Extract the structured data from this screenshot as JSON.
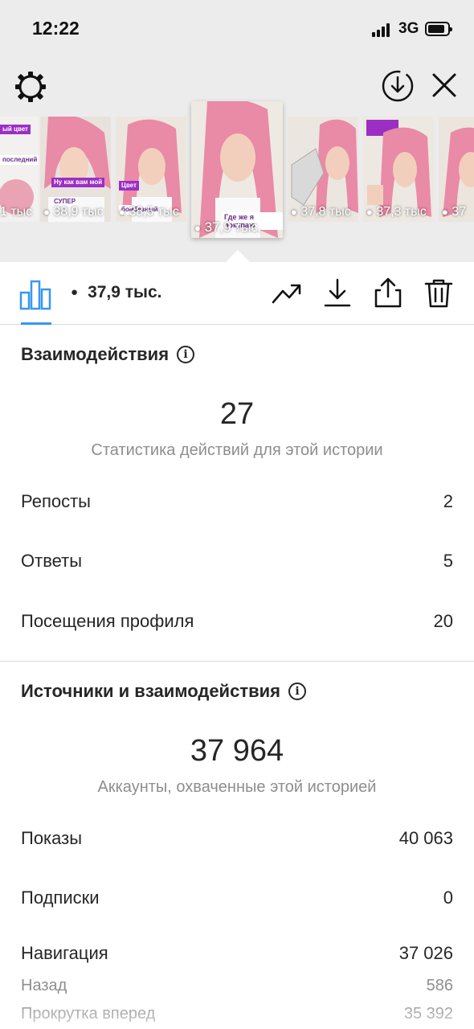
{
  "status_bar": {
    "time": "12:22",
    "network": "3G"
  },
  "header": {
    "settings_icon": "gear-icon",
    "download_icon": "download-circle-icon",
    "close_icon": "close-icon"
  },
  "stories": [
    {
      "count": "1 тыс",
      "tag1": "ый цвет",
      "tag2": "последний"
    },
    {
      "count": "38,9 тыс",
      "tag1": "Ну как вам мой",
      "tag2": "СУПЕР"
    },
    {
      "count": "38,5 тыс",
      "tag1": "Цвет",
      "tag2": "бомбезный"
    },
    {
      "count": "37,9 тыс.",
      "tag1": "Где же я покупаю",
      "tag2": ""
    },
    {
      "count": "37,8 тыс",
      "tag1": "",
      "tag2": ""
    },
    {
      "count": "37,3 тыс",
      "tag1": "",
      "tag2": ""
    },
    {
      "count": "37",
      "tag1": "",
      "tag2": ""
    }
  ],
  "toolbar": {
    "views": "37,9 тыс.",
    "icons": [
      "bar-chart-icon",
      "trend-icon",
      "download-icon",
      "share-icon",
      "trash-icon"
    ]
  },
  "interactions": {
    "title": "Взаимодействия",
    "total": "27",
    "subtitle": "Статистика действий для этой истории",
    "rows": [
      {
        "label": "Репосты",
        "value": "2"
      },
      {
        "label": "Ответы",
        "value": "5"
      },
      {
        "label": "Посещения профиля",
        "value": "20"
      }
    ]
  },
  "discovery": {
    "title": "Источники и взаимодействия",
    "total": "37 964",
    "subtitle": "Аккаунты, охваченные этой историей",
    "rows": [
      {
        "label": "Показы",
        "value": "40 063"
      },
      {
        "label": "Подписки",
        "value": "0"
      },
      {
        "label": "Навигация",
        "value": "37 026"
      }
    ],
    "sub_rows": [
      {
        "label": "Назад",
        "value": "586"
      },
      {
        "label": "Прокрутка вперед",
        "value": "35 392"
      }
    ]
  },
  "colors": {
    "accent": "#3897f0",
    "hair": "#e98aa6",
    "tag": "#9b2fc4"
  }
}
